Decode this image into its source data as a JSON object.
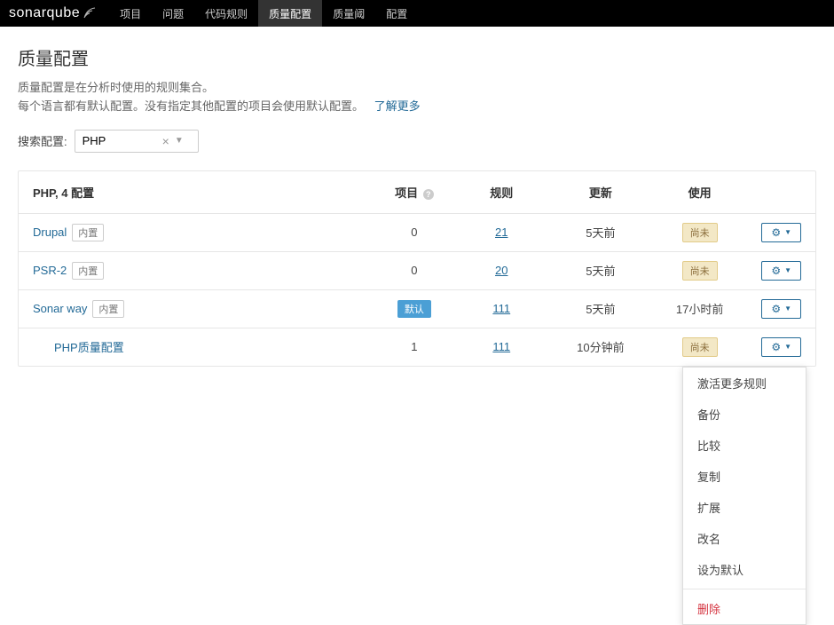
{
  "brand": {
    "name1": "sonar",
    "name2": "qube"
  },
  "nav": {
    "items": [
      {
        "label": "项目"
      },
      {
        "label": "问题"
      },
      {
        "label": "代码规则"
      },
      {
        "label": "质量配置",
        "active": true
      },
      {
        "label": "质量阈"
      },
      {
        "label": "配置"
      }
    ]
  },
  "page": {
    "title": "质量配置",
    "desc1": "质量配置是在分析时使用的规则集合。",
    "desc2": "每个语言都有默认配置。没有指定其他配置的项目会使用默认配置。",
    "learn_more": "了解更多"
  },
  "search": {
    "label": "搜索配置:",
    "value": "PHP"
  },
  "table": {
    "header_lang": "PHP, 4 配置",
    "cols": {
      "projects": "项目",
      "rules": "规则",
      "updated": "更新",
      "used": "使用"
    },
    "builtin_label": "内置",
    "default_label": "默认",
    "unused_label": "尚未",
    "rows": [
      {
        "name": "Drupal",
        "builtin": true,
        "projects": "0",
        "rules": "21",
        "updated": "5天前",
        "used": "unused",
        "indent": false
      },
      {
        "name": "PSR-2",
        "builtin": true,
        "projects": "0",
        "rules": "20",
        "updated": "5天前",
        "used": "unused",
        "indent": false
      },
      {
        "name": "Sonar way",
        "builtin": true,
        "projects": "",
        "projects_default": true,
        "rules": "111",
        "updated": "5天前",
        "used": "17小时前",
        "indent": false
      },
      {
        "name": "PHP质量配置",
        "builtin": false,
        "projects": "1",
        "rules": "111",
        "updated": "10分钟前",
        "used": "unused",
        "indent": true
      }
    ]
  },
  "dropdown": {
    "items": [
      "激活更多规则",
      "备份",
      "比较",
      "复制",
      "扩展",
      "改名",
      "设为默认"
    ],
    "delete": "删除"
  }
}
